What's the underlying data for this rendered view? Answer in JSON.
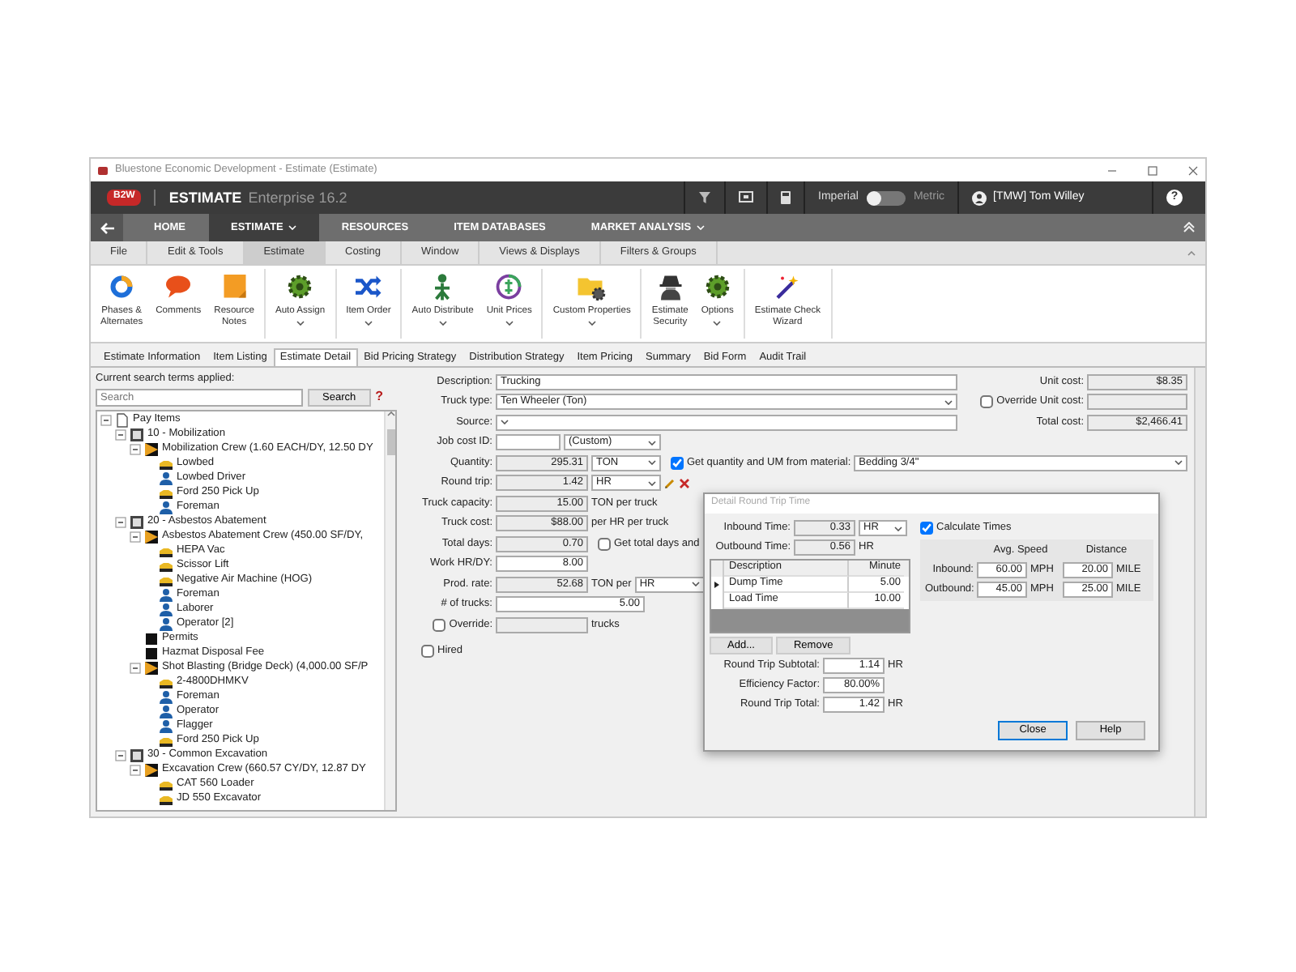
{
  "window": {
    "title": "Bluestone Economic Development - Estimate (Estimate)"
  },
  "app_bar": {
    "logo": "B2W",
    "product": "ESTIMATE",
    "edition": "Enterprise 16.2",
    "units_toggle": {
      "left_label": "Imperial",
      "right_label": "Metric",
      "on": false
    },
    "user": "[TMW] Tom Willey",
    "help": "?"
  },
  "nav": [
    {
      "label": "HOME",
      "selected": false,
      "dropdown": false
    },
    {
      "label": "ESTIMATE",
      "selected": true,
      "dropdown": true
    },
    {
      "label": "RESOURCES",
      "selected": false,
      "dropdown": false
    },
    {
      "label": "ITEM DATABASES",
      "selected": false,
      "dropdown": false
    },
    {
      "label": "MARKET ANALYSIS",
      "selected": false,
      "dropdown": true
    }
  ],
  "ribbon_tabs": [
    {
      "label": "File",
      "selected": false
    },
    {
      "label": "Edit & Tools",
      "selected": false
    },
    {
      "label": "Estimate",
      "selected": true
    },
    {
      "label": "Costing",
      "selected": false
    },
    {
      "label": "Window",
      "selected": false
    },
    {
      "label": "Views & Displays",
      "selected": false
    },
    {
      "label": "Filters & Groups",
      "selected": false
    }
  ],
  "ribbon": {
    "groups": [
      [
        {
          "label": "Phases &\nAlternates",
          "kind": "ring",
          "dropdown": false
        },
        {
          "label": "Comments",
          "kind": "bubble",
          "dropdown": false
        },
        {
          "label": "Resource\nNotes",
          "kind": "note",
          "dropdown": false
        }
      ],
      [
        {
          "label": "Auto Assign",
          "kind": "gear",
          "dropdown": true
        }
      ],
      [
        {
          "label": "Item Order",
          "kind": "shuffle",
          "dropdown": true
        }
      ],
      [
        {
          "label": "Auto Distribute",
          "kind": "person",
          "dropdown": true
        },
        {
          "label": "Unit Prices",
          "kind": "coin",
          "dropdown": true
        }
      ],
      [
        {
          "label": "Custom Properties",
          "kind": "folder",
          "dropdown": true
        }
      ],
      [
        {
          "label": "Estimate\nSecurity",
          "kind": "spy",
          "dropdown": false
        },
        {
          "label": "Options",
          "kind": "gear",
          "dropdown": true
        }
      ],
      [
        {
          "label": "Estimate Check\nWizard",
          "kind": "wand",
          "dropdown": false
        }
      ]
    ]
  },
  "detail_tabs": [
    {
      "label": "Estimate Information",
      "selected": false
    },
    {
      "label": "Item Listing",
      "selected": false
    },
    {
      "label": "Estimate Detail",
      "selected": true
    },
    {
      "label": "Bid Pricing Strategy",
      "selected": false
    },
    {
      "label": "Distribution Strategy",
      "selected": false
    },
    {
      "label": "Item Pricing",
      "selected": false
    },
    {
      "label": "Summary",
      "selected": false
    },
    {
      "label": "Bid Form",
      "selected": false
    },
    {
      "label": "Audit Trail",
      "selected": false
    }
  ],
  "search": {
    "caption": "Current search terms applied:",
    "placeholder": "Search",
    "button": "Search",
    "help": "?"
  },
  "tree": [
    {
      "label": "Pay Items",
      "kind": "root",
      "expanded": true,
      "children": [
        {
          "label": "10 - Mobilization",
          "kind": "pay",
          "expanded": true,
          "children": [
            {
              "label": "Mobilization Crew (1.60 EACH/DY, 12.50 DY",
              "kind": "crew",
              "expanded": true,
              "children": [
                {
                  "label": "Lowbed",
                  "kind": "equipment"
                },
                {
                  "label": "Lowbed Driver",
                  "kind": "labor"
                },
                {
                  "label": "Ford 250 Pick Up",
                  "kind": "equipment"
                },
                {
                  "label": "Foreman",
                  "kind": "labor"
                }
              ]
            }
          ]
        },
        {
          "label": "20 - Asbestos Abatement",
          "kind": "pay",
          "expanded": true,
          "children": [
            {
              "label": "Asbestos Abatement Crew (450.00 SF/DY,",
              "kind": "crew",
              "expanded": true,
              "children": [
                {
                  "label": "HEPA Vac",
                  "kind": "equipment"
                },
                {
                  "label": "Scissor Lift",
                  "kind": "equipment"
                },
                {
                  "label": "Negative Air Machine (HOG)",
                  "kind": "equipment"
                },
                {
                  "label": "Foreman",
                  "kind": "labor"
                },
                {
                  "label": "Laborer",
                  "kind": "labor"
                },
                {
                  "label": "Operator [2]",
                  "kind": "labor"
                }
              ]
            },
            {
              "label": "Permits",
              "kind": "material"
            },
            {
              "label": "Hazmat Disposal Fee",
              "kind": "material"
            },
            {
              "label": "Shot Blasting (Bridge Deck) (4,000.00 SF/P",
              "kind": "crew",
              "expanded": true,
              "children": [
                {
                  "label": "2-4800DHMKV",
                  "kind": "equipment"
                },
                {
                  "label": "Foreman",
                  "kind": "labor"
                },
                {
                  "label": "Operator",
                  "kind": "labor"
                },
                {
                  "label": "Flagger",
                  "kind": "labor"
                },
                {
                  "label": "Ford 250 Pick Up",
                  "kind": "equipment"
                }
              ]
            }
          ]
        },
        {
          "label": "30 - Common Excavation",
          "kind": "pay",
          "expanded": true,
          "children": [
            {
              "label": "Excavation Crew (660.57 CY/DY, 12.87 DY",
              "kind": "crew",
              "expanded": true,
              "children": [
                {
                  "label": "CAT 560 Loader",
                  "kind": "equipment"
                },
                {
                  "label": "JD 550 Excavator",
                  "kind": "equipment"
                }
              ]
            }
          ]
        }
      ]
    }
  ],
  "form": {
    "top_rows": [
      {
        "label": "Description:",
        "controls": [
          {
            "kind": "text",
            "value": "Trucking"
          }
        ]
      },
      {
        "label": "Truck type:",
        "controls": [
          {
            "kind": "combo",
            "value": "Ten Wheeler (Ton)"
          }
        ]
      },
      {
        "label": "Source:",
        "controls": [
          {
            "kind": "combo"
          }
        ]
      }
    ],
    "cost": [
      {
        "label": "Unit cost:",
        "value": "$8.35"
      },
      {
        "label": "Override Unit cost:",
        "checked": false
      },
      {
        "label": "Total cost:",
        "value": "$2,466.41"
      }
    ],
    "rows": [
      {
        "label": "Job cost ID:",
        "controls": [
          {
            "kind": "id"
          },
          {
            "kind": "pick",
            "value": "(Custom)"
          }
        ]
      },
      {
        "label": "Quantity:",
        "controls": [
          {
            "kind": "number",
            "value": "295.31",
            "readonly": true
          },
          {
            "kind": "unit",
            "value": "TON"
          },
          {
            "kind": "check",
            "label": "Get quantity and UM from material:",
            "checked": true
          },
          {
            "kind": "material",
            "value": "Bedding 3/4\""
          }
        ]
      },
      {
        "label": "Round trip:",
        "controls": [
          {
            "kind": "number",
            "value": "1.42",
            "readonly": true
          },
          {
            "kind": "unit",
            "value": "HR"
          },
          {
            "kind": "edit"
          },
          {
            "kind": "delete"
          }
        ]
      },
      {
        "label": "Truck capacity:",
        "controls": [
          {
            "kind": "number",
            "value": "15.00",
            "readonly": true
          },
          {
            "kind": "note",
            "value": "TON per truck"
          }
        ]
      },
      {
        "label": "Truck cost:",
        "controls": [
          {
            "kind": "number",
            "value": "$88.00",
            "readonly": true
          },
          {
            "kind": "note",
            "value": "per HR per truck"
          }
        ]
      },
      {
        "label": "Total days:",
        "controls": [
          {
            "kind": "number",
            "value": "0.70",
            "readonly": true
          },
          {
            "kind": "check",
            "label": "Get total days and",
            "checked": false
          }
        ]
      },
      {
        "label": "Work HR/DY:",
        "controls": [
          {
            "kind": "number",
            "value": "8.00",
            "readonly": false
          }
        ]
      },
      {
        "label": "Prod. rate:",
        "controls": [
          {
            "kind": "number",
            "value": "52.68",
            "readonly": true
          },
          {
            "kind": "note",
            "value": "TON per"
          },
          {
            "kind": "unit",
            "value": "HR"
          }
        ]
      },
      {
        "label": "# of trucks:",
        "controls": [
          {
            "kind": "count",
            "value": "5.00"
          }
        ]
      },
      {
        "label": "Override:",
        "checked": false,
        "controls": [
          {
            "kind": "blank"
          },
          {
            "kind": "note",
            "value": "trucks"
          }
        ]
      },
      {
        "kind": "check",
        "label": "Hired",
        "checked": false
      }
    ]
  },
  "dialog": {
    "title": "Detail Round Trip Time",
    "times": [
      {
        "label": "Inbound Time:",
        "value": "0.33",
        "unit": "HR",
        "unit_dropdown": true
      },
      {
        "label": "Outbound Time:",
        "value": "0.56",
        "unit": "HR",
        "unit_dropdown": false
      }
    ],
    "grid": {
      "columns": [
        "Description",
        "Minute"
      ],
      "rows": [
        {
          "cells": [
            "Dump Time",
            "5.00"
          ],
          "selected": true
        },
        {
          "cells": [
            "Load Time",
            "10.00"
          ],
          "selected": false
        }
      ]
    },
    "grid_buttons": [
      "Add...",
      "Remove"
    ],
    "totals": [
      {
        "label": "Round Trip Subtotal:",
        "value": "1.14",
        "unit": "HR"
      },
      {
        "label": "Efficiency Factor:",
        "value": "80.00%"
      },
      {
        "label": "Round Trip Total:",
        "value": "1.42",
        "unit": "HR"
      }
    ],
    "calculate": {
      "label": "Calculate Times",
      "checked": true
    },
    "calc_columns": [
      "Avg. Speed",
      "Distance"
    ],
    "calc_rows": [
      {
        "label": "Inbound:",
        "speed": "60.00",
        "speed_unit": "MPH",
        "distance": "20.00",
        "distance_unit": "MILE"
      },
      {
        "label": "Outbound:",
        "speed": "45.00",
        "speed_unit": "MPH",
        "distance": "25.00",
        "distance_unit": "MILE"
      }
    ],
    "buttons": [
      {
        "label": "Close",
        "default": true
      },
      {
        "label": "Help",
        "default": false
      }
    ]
  }
}
